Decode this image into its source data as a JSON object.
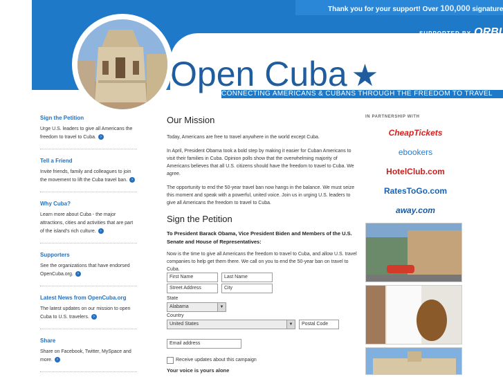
{
  "header": {
    "thanks_prefix": "Thank you for your support! Over",
    "thanks_count": "100,000",
    "thanks_suffix": "signatures and co",
    "supported_by": "SUPPORTED BY",
    "sponsor": "ORBI",
    "logo_text": "Open Cuba",
    "logo_star": "★",
    "tagline": "CONNECTING AMERICANS & CUBANS THROUGH THE FREEDOM TO TRAVEL"
  },
  "sidebar": {
    "items": [
      {
        "title": "Sign the Petition",
        "text": "Urge U.S. leaders to give all Americans the freedom to travel to Cuba."
      },
      {
        "title": "Tell a Friend",
        "text": "Invite friends, family and colleagues to join the movement to lift the Cuba travel ban."
      },
      {
        "title": "Why Cuba?",
        "text": "Learn more about Cuba - the major attractions, cities and activities that are part of the island's rich culture."
      },
      {
        "title": "Supporters",
        "text": "See the organizations that have endorsed OpenCuba.org."
      },
      {
        "title": "Latest News from OpenCuba.org",
        "text": "The latest updates on our mission to open Cuba to U.S. travelers."
      },
      {
        "title": "Share",
        "text": "Share on Facebook, Twitter, MySpace and more."
      }
    ],
    "arrow_glyph": "›"
  },
  "main": {
    "mission_title": "Our Mission",
    "mission_p1": "Today, Americans are free to travel anywhere in the world except Cuba.",
    "mission_p2": "In April, President Obama took a bold step by making it easier for Cuban Americans to visit their families in Cuba. Opinion polls show that the overwhelming majority of Americans believes that all U.S. citizens should have the freedom to travel to Cuba. We agree.",
    "mission_p3": "The opportunity to end the 50-year travel ban now hangs in the balance. We must seize this moment and speak with a powerful, united voice. Join us in urging U.S. leaders to give all Americans the freedom to travel to Cuba.",
    "petition_title": "Sign the Petition",
    "petition_to": "To President Barack Obama, Vice President Biden and Members of the U.S. Senate and House of Representatives:",
    "petition_text": "Now is the time to give all Americans the freedom to travel to Cuba, and allow U.S. travel companies to help get them there. We call on you to end the 50-year ban on travel to Cuba.",
    "form": {
      "first_name": "First Name",
      "last_name": "Last Name",
      "street": "Street Address",
      "city": "City",
      "state_label": "State",
      "state_value": "Alabama",
      "country_label": "Country",
      "country_value": "United States",
      "postal": "Postal Code",
      "email": "Email address",
      "updates_label": "Receive updates about this campaign",
      "voice_label": "Your voice is yours alone"
    }
  },
  "partners": {
    "title": "IN PARTNERSHIP WITH",
    "items": [
      "CheapTickets",
      "ebookers",
      "HotelClub.com",
      "RatesToGo.com",
      "away.com"
    ]
  },
  "colors": {
    "header_blue": "#1f79c9",
    "link_blue": "#2470c0",
    "logo_blue": "#1f5d9e"
  }
}
